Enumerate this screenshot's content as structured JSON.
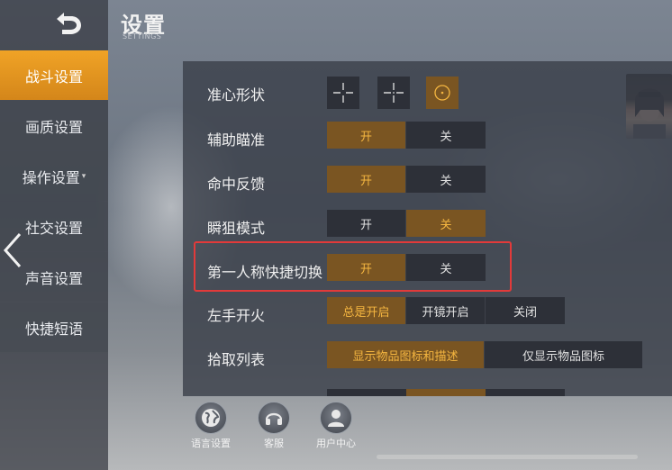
{
  "header": {
    "title": "设置",
    "subtitle": "SETTINGS"
  },
  "sidebar": {
    "items": [
      {
        "label": "战斗设置",
        "active": true
      },
      {
        "label": "画质设置",
        "active": false
      },
      {
        "label": "操作设置",
        "active": false,
        "caret": "▾"
      },
      {
        "label": "社交设置",
        "active": false
      },
      {
        "label": "声音设置",
        "active": false
      },
      {
        "label": "快捷短语",
        "active": false
      }
    ]
  },
  "settings": {
    "crosshair": {
      "label": "准心形状",
      "options": [
        "crosshair-icon",
        "crosshair-icon",
        "circle-dot-icon"
      ],
      "selected": 2
    },
    "aim_assist": {
      "label": "辅助瞄准",
      "options": [
        "开",
        "关"
      ],
      "selected": 0
    },
    "hit_feedback": {
      "label": "命中反馈",
      "options": [
        "开",
        "关"
      ],
      "selected": 0
    },
    "quick_scope": {
      "label": "瞬狙模式",
      "options": [
        "开",
        "关"
      ],
      "selected": 1
    },
    "first_person_switch": {
      "label": "第一人称快捷切换",
      "options": [
        "开",
        "关"
      ],
      "selected": 0,
      "highlighted": true
    },
    "left_fire": {
      "label": "左手开火",
      "options": [
        "总是开启",
        "开镜开启",
        "关闭"
      ],
      "selected": 0
    },
    "pickup_list": {
      "label": "拾取列表",
      "options": [
        "显示物品图标和描述",
        "仅显示物品图标"
      ],
      "selected": 0
    }
  },
  "footer": {
    "language": "语言设置",
    "support": "客服",
    "user_center": "用户中心"
  },
  "colors": {
    "accent": "#f0a326",
    "highlight_border": "#e23a3a",
    "on_bg": "#7a5522",
    "on_text": "#f5b640"
  }
}
